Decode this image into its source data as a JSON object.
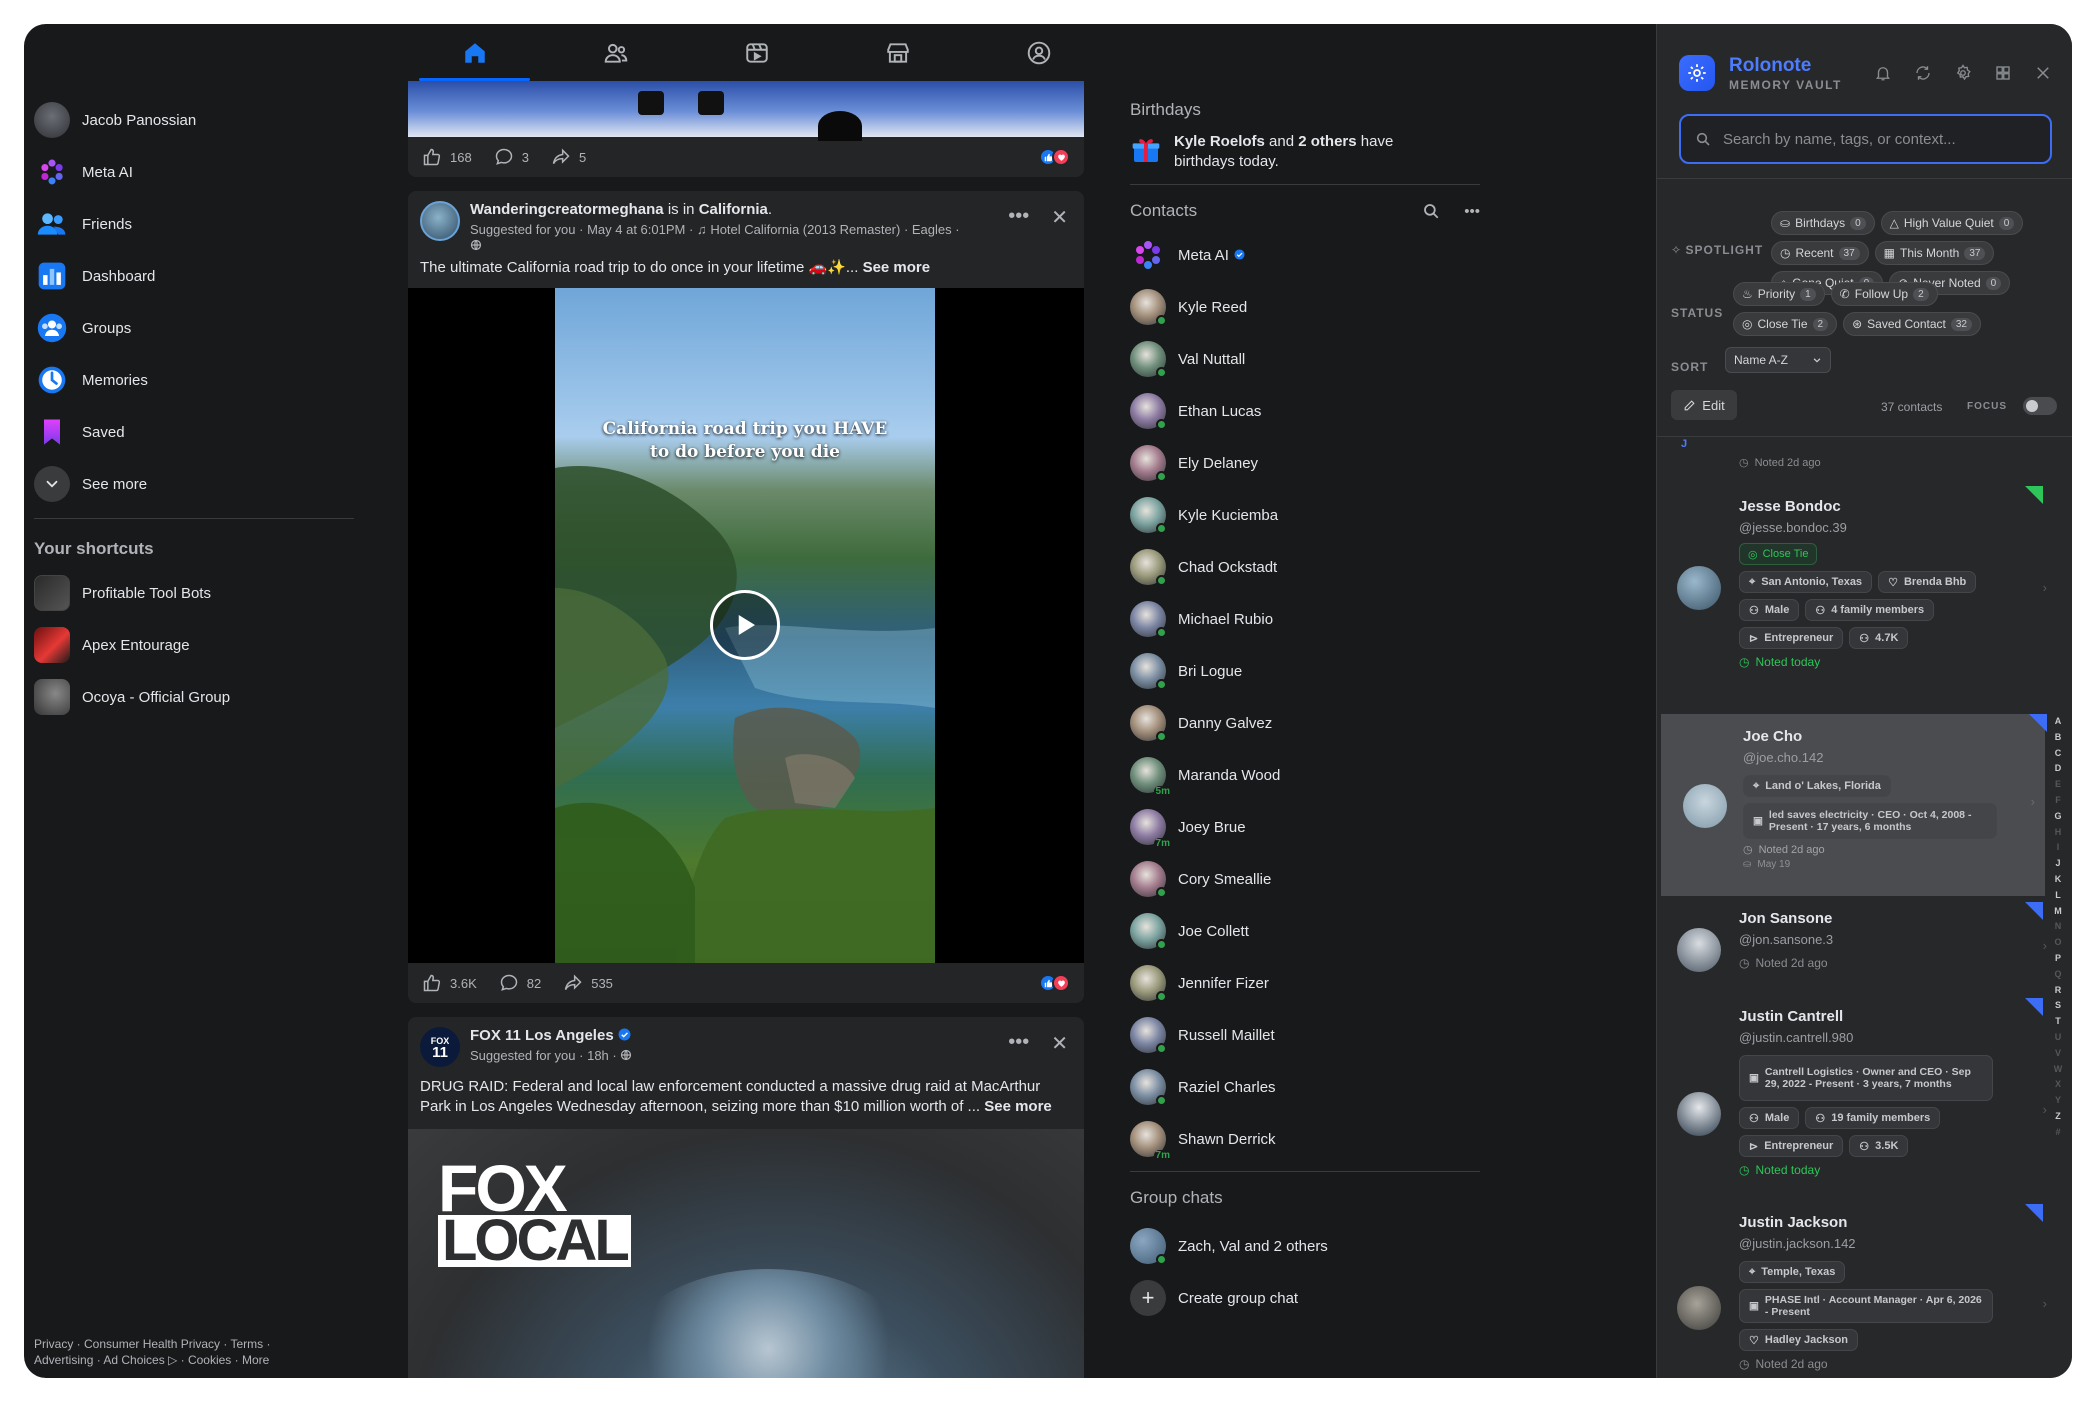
{
  "nav": {
    "tabs": [
      {
        "name": "home-icon",
        "active": true
      },
      {
        "name": "friends-icon",
        "active": false
      },
      {
        "name": "video-icon",
        "active": false
      },
      {
        "name": "marketplace-icon",
        "active": false
      },
      {
        "name": "groups-icon",
        "active": false
      }
    ]
  },
  "sidebar": {
    "items": [
      {
        "label": "Jacob Panossian",
        "icon": "profile-avatar"
      },
      {
        "label": "Meta AI",
        "icon": "meta-ai-icon"
      },
      {
        "label": "Friends",
        "icon": "friends-icon"
      },
      {
        "label": "Dashboard",
        "icon": "dashboard-icon"
      },
      {
        "label": "Groups",
        "icon": "groups-icon"
      },
      {
        "label": "Memories",
        "icon": "memories-icon"
      },
      {
        "label": "Saved",
        "icon": "saved-icon"
      },
      {
        "label": "See more",
        "icon": "chevron-down-icon"
      }
    ],
    "shortcuts_title": "Your shortcuts",
    "shortcuts": [
      {
        "label": "Profitable Tool Bots"
      },
      {
        "label": "Apex Entourage"
      },
      {
        "label": "Ocoya - Official Group"
      }
    ],
    "footer_line1": "Privacy · Consumer Health Privacy · Terms ·",
    "footer_line2": "Advertising · Ad Choices ▷ · Cookies · More"
  },
  "feed": {
    "post0": {
      "likes": "168",
      "comments": "3",
      "shares": "5"
    },
    "post1": {
      "author": "Wanderingcreatormeghana",
      "is_in": "is in",
      "place": "California",
      "suggested": "Suggested for you",
      "time": "May 4 at 6:01PM",
      "music": "Hotel California (2013 Remaster) · Eagles ·",
      "text": "The ultimate California road trip to do once in your lifetime 🚗✨...",
      "see_more": "See more",
      "overlay_line1": "California road trip you HAVE",
      "overlay_line2": "to do before you die",
      "likes": "3.6K",
      "comments": "82",
      "shares": "535"
    },
    "post2": {
      "author": "FOX 11 Los Angeles",
      "logo_top": "FOX",
      "logo_num": "11",
      "suggested": "Suggested for you",
      "time": "18h",
      "text": "DRUG RAID: Federal and local law enforcement conducted a massive drug raid at MacArthur Park in Los Angeles Wednesday afternoon, seizing more than $10 million worth of ...",
      "see_more": "See more",
      "image_line1": "FOX",
      "image_line2": "LOCAL"
    }
  },
  "right": {
    "birthdays_title": "Birthdays",
    "birthday_name": "Kyle Roelofs",
    "birthday_and": "and",
    "birthday_others": "2 others",
    "birthday_have": "have",
    "birthday_line2": "birthdays today.",
    "contacts_title": "Contacts",
    "contacts": [
      {
        "name": "Meta AI",
        "badge": ""
      },
      {
        "name": "Kyle Reed",
        "badge": "dot"
      },
      {
        "name": "Val Nuttall",
        "badge": "dot"
      },
      {
        "name": "Ethan Lucas",
        "badge": "dot"
      },
      {
        "name": "Ely Delaney",
        "badge": "dot"
      },
      {
        "name": "Kyle Kuciemba",
        "badge": "dot"
      },
      {
        "name": "Chad Ockstadt",
        "badge": "dot"
      },
      {
        "name": "Michael Rubio",
        "badge": "dot"
      },
      {
        "name": "Bri Logue",
        "badge": "dot"
      },
      {
        "name": "Danny Galvez",
        "badge": "dot"
      },
      {
        "name": "Maranda Wood",
        "badge": "5m"
      },
      {
        "name": "Joey Brue",
        "badge": "7m"
      },
      {
        "name": "Cory Smeallie",
        "badge": "dot"
      },
      {
        "name": "Joe Collett",
        "badge": "dot"
      },
      {
        "name": "Jennifer Fizer",
        "badge": "dot"
      },
      {
        "name": "Russell Maillet",
        "badge": "dot"
      },
      {
        "name": "Raziel Charles",
        "badge": "dot"
      },
      {
        "name": "Shawn Derrick",
        "badge": "7m"
      }
    ],
    "group_chats_title": "Group chats",
    "group_chat": "Zach, Val and 2 others",
    "create_group": "Create group chat"
  },
  "rolonote": {
    "brand": "Rolonote",
    "subtitle": "MEMORY VAULT",
    "search_placeholder": "Search by name, tags, or context...",
    "spotlight_label": "SPOTLIGHT",
    "status_label": "STATUS",
    "sort_label": "SORT",
    "focus_label": "FOCUS",
    "spotlight_chips": [
      {
        "label": "Birthdays",
        "count": "0"
      },
      {
        "label": "High Value Quiet",
        "count": "0"
      },
      {
        "label": "Recent",
        "count": "37"
      },
      {
        "label": "This Month",
        "count": "37"
      },
      {
        "label": "Gone Quiet",
        "count": "0"
      },
      {
        "label": "Never Noted",
        "count": "0"
      }
    ],
    "status_chips": [
      {
        "label": "Priority",
        "count": "1"
      },
      {
        "label": "Follow Up",
        "count": "2"
      },
      {
        "label": "Close Tie",
        "count": "2"
      },
      {
        "label": "Saved Contact",
        "count": "32"
      }
    ],
    "sort_value": "Name A-Z",
    "edit_label": "Edit",
    "contacts_count": "37 contacts",
    "letter_j": "J",
    "prev_noted": "Noted 2d ago",
    "cards": {
      "jesse": {
        "name": "Jesse Bondoc",
        "handle": "@jesse.bondoc.39",
        "status": "Close Tie",
        "tags": [
          "San Antonio, Texas",
          "Brenda Bhb",
          "Male",
          "4 family members",
          "Entrepreneur",
          "4.7K"
        ],
        "noted": "Noted today"
      },
      "joe": {
        "name": "Joe Cho",
        "handle": "@joe.cho.142",
        "location": "Land o' Lakes, Florida",
        "work": "led saves electricity · CEO · Oct 4, 2008 - Present · 17 years, 6 months",
        "noted": "Noted 2d ago",
        "date": "May 19"
      },
      "jon": {
        "name": "Jon Sansone",
        "handle": "@jon.sansone.3",
        "noted": "Noted 2d ago"
      },
      "justinc": {
        "name": "Justin Cantrell",
        "handle": "@justin.cantrell.980",
        "work": "Cantrell Logistics · Owner and CEO · Sep 29, 2022 - Present · 3 years, 7 months",
        "tags": [
          "Male",
          "19 family members",
          "Entrepreneur",
          "3.5K"
        ],
        "noted": "Noted today"
      },
      "justinj": {
        "name": "Justin Jackson",
        "handle": "@justin.jackson.142",
        "location": "Temple, Texas",
        "work": "PHASE Intl · Account Manager · Apr 6, 2026 - Present",
        "partner": "Hadley Jackson",
        "noted": "Noted 2d ago"
      }
    },
    "alphabet": [
      "A",
      "B",
      "C",
      "D",
      "E",
      "F",
      "G",
      "H",
      "I",
      "J",
      "K",
      "L",
      "M",
      "N",
      "O",
      "P",
      "Q",
      "R",
      "S",
      "T",
      "U",
      "V",
      "W",
      "X",
      "Y",
      "Z",
      "#"
    ],
    "alphabet_active": [
      "A",
      "B",
      "C",
      "D",
      "G",
      "J",
      "K",
      "L",
      "M",
      "P",
      "R",
      "S",
      "T",
      "Z"
    ]
  },
  "colors": {
    "accent": "#0866ff",
    "online": "#31a24c",
    "rolonote_blue": "#3d6df5",
    "noted_green": "#2ec55a",
    "background": "#18191a",
    "card": "#242526"
  }
}
